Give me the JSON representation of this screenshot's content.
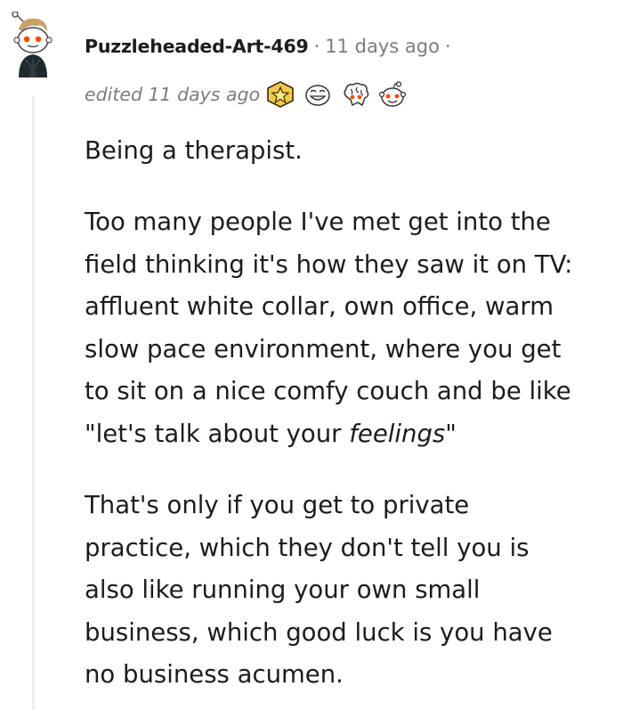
{
  "comment": {
    "author": "Puzzleheaded-Art-469",
    "separator": "·",
    "posted": "11 days ago",
    "trailing_separator": "·",
    "edited": "edited 11 days ago",
    "awards": [
      "star-badge-icon",
      "grin-face-award-icon",
      "brain-award-icon",
      "snoo-face-award-icon"
    ],
    "paragraph1": "Being a therapist.",
    "paragraph2_lines": [
      "Too many people I've met get into the",
      "field thinking it's how they saw it on TV:",
      "affluent white collar, own office, warm",
      "slow pace environment, where you get",
      "to sit on a nice comfy couch and be like"
    ],
    "paragraph2_last_prefix": "\"let's talk about your ",
    "paragraph2_last_emphasis": "feelings",
    "paragraph2_last_suffix": "\"",
    "paragraph3_lines": [
      "That's only if you get to private",
      "practice, which they don't tell you is",
      "also like running your own small",
      "business, which good luck is you have",
      "no business acumen."
    ]
  },
  "colors": {
    "meta_text": "#7c7c7c",
    "body_text": "#1c1c1c",
    "thread_line": "#edeff1",
    "award_gold": "#f2c94c"
  }
}
